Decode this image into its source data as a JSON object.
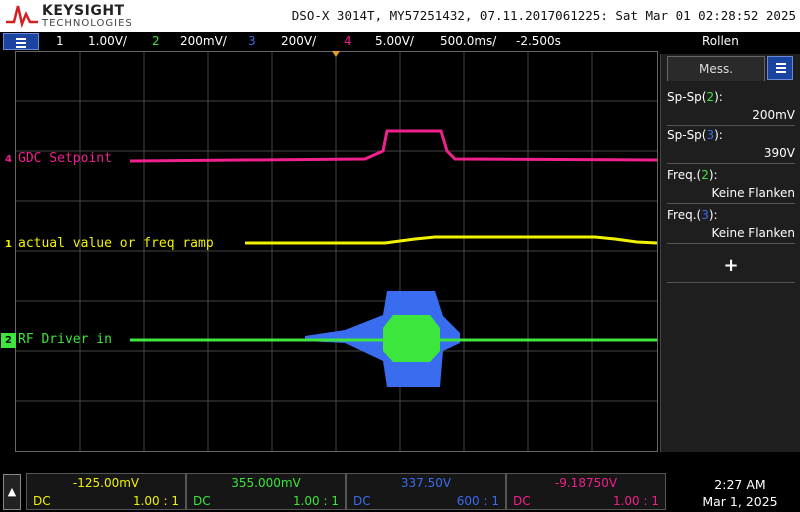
{
  "header": {
    "brand": "KEYSIGHT",
    "brand_sub": "TECHNOLOGIES",
    "instrument_info": "DSO-X 3014T, MY57251432, 07.11.2017061225: Sat Mar 01 02:28:52 2025"
  },
  "channel_bar": {
    "ch1_num": "1",
    "ch1_scale": "1.00V/",
    "ch2_num": "2",
    "ch2_scale": "200mV/",
    "ch3_num": "3",
    "ch3_scale": "200V/",
    "ch4_num": "4",
    "ch4_scale": "5.00V/",
    "timebase": "500.0ms/",
    "delay": "-2.500s",
    "mode": "Rollen"
  },
  "traces": {
    "ch4_label": "GDC Setpoint",
    "ch1_label": "actual value or freq ramp",
    "ch2_label": "RF Driver in",
    "ch4_marker": "4",
    "ch1_marker": "1",
    "ch2_marker": "2"
  },
  "side_panel": {
    "tab_label": "Mess.",
    "measurements": [
      {
        "name": "Sp-Sp(",
        "ch": "2",
        "close": "):",
        "value": "200mV"
      },
      {
        "name": "Sp-Sp(",
        "ch": "3",
        "close": "):",
        "value": "390V"
      },
      {
        "name": "Freq.(",
        "ch": "2",
        "close": "):",
        "value": "Keine Flanken"
      },
      {
        "name": "Freq.(",
        "ch": "3",
        "close": "):",
        "value": "Keine Flanken"
      }
    ],
    "add_label": "+"
  },
  "bottom_bar": {
    "scroll_icon": "up-arrow-icon",
    "channels": [
      {
        "value": "-125.00mV",
        "coupling": "DC",
        "ratio": "1.00 : 1"
      },
      {
        "value": "355.000mV",
        "coupling": "DC",
        "ratio": "1.00 : 1"
      },
      {
        "value": "337.50V",
        "coupling": "DC",
        "ratio": "600 : 1"
      },
      {
        "value": "-9.18750V",
        "coupling": "DC",
        "ratio": "1.00 : 1"
      }
    ],
    "time": "2:27 AM",
    "date": "Mar 1, 2025"
  },
  "colors": {
    "ch1": "#f2f200",
    "ch2": "#3ce63c",
    "ch3": "#3a6cf0",
    "ch4": "#f0208c",
    "accent": "#1a44a0"
  }
}
